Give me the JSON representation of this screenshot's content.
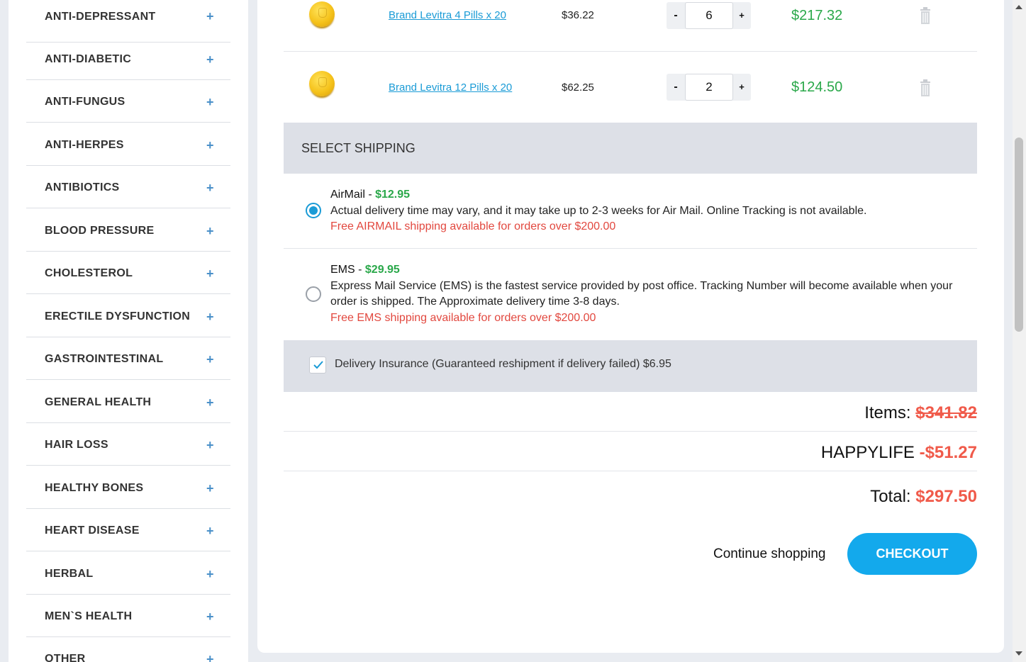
{
  "sidebar": {
    "items": [
      {
        "label": "ANTI-DEPRESSANT"
      },
      {
        "label": "ANTI-DIABETIC"
      },
      {
        "label": "ANTI-FUNGUS"
      },
      {
        "label": "ANTI-HERPES"
      },
      {
        "label": "ANTIBIOTICS"
      },
      {
        "label": "BLOOD PRESSURE"
      },
      {
        "label": "CHOLESTEROL"
      },
      {
        "label": "ERECTILE DYSFUNCTION"
      },
      {
        "label": "GASTROINTESTINAL"
      },
      {
        "label": "GENERAL HEALTH"
      },
      {
        "label": "HAIR LOSS"
      },
      {
        "label": "HEALTHY BONES"
      },
      {
        "label": "HEART DISEASE"
      },
      {
        "label": "HERBAL"
      },
      {
        "label": "MEN`S HEALTH"
      },
      {
        "label": "OTHER"
      }
    ],
    "expand_symbol": "+"
  },
  "cart": {
    "items": [
      {
        "name": "Brand Levitra 4 Pills x 20",
        "unit_price": "$36.22",
        "quantity": "6",
        "total": "$217.32"
      },
      {
        "name": "Brand Levitra 12 Pills x 20",
        "unit_price": "$62.25",
        "quantity": "2",
        "total": "$124.50"
      }
    ],
    "qty_minus": "-",
    "qty_plus": "+"
  },
  "shipping": {
    "title": "SELECT SHIPPING",
    "options": [
      {
        "name": "AirMail",
        "price": "$12.95",
        "description": "Actual delivery time may vary, and it may take up to 2-3 weeks for Air Mail. Online Tracking is not available.",
        "free_note": "Free AIRMAIL shipping available for orders over $200.00",
        "selected": true
      },
      {
        "name": "EMS",
        "price": "$29.95",
        "description": "Express Mail Service (EMS) is the fastest service provided by post office. Tracking Number will become available when your order is shipped. The Approximate delivery time 3-8 days.",
        "free_note": "Free EMS shipping available for orders over $200.00",
        "selected": false
      }
    ],
    "separator": " - "
  },
  "insurance": {
    "label": "Delivery Insurance (Guaranteed reshipment if delivery failed) $6.95",
    "checked": true
  },
  "summary": {
    "items_label": "Items: ",
    "items_value": "$341.82",
    "coupon_label": "HAPPYLIFE ",
    "coupon_value": "-$51.27",
    "total_label": "Total: ",
    "total_value": "$297.50"
  },
  "actions": {
    "continue_label": "Continue shopping",
    "checkout_label": "CHECKOUT"
  },
  "colors": {
    "accent_blue": "#13a9ec",
    "link_blue": "#1a9bd6",
    "price_green": "#2aa84a",
    "alert_red": "#e2483f",
    "summary_red": "#f05a4a"
  }
}
